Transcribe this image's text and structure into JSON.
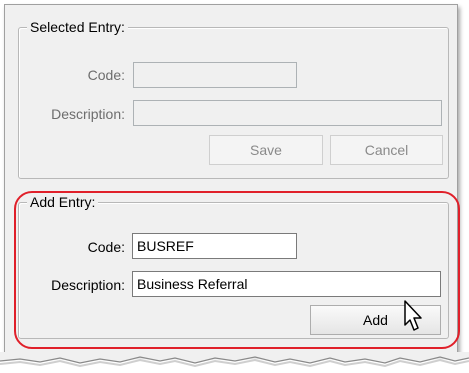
{
  "selected_entry": {
    "title": "Selected Entry:",
    "code_label": "Code:",
    "code_value": "",
    "description_label": "Description:",
    "description_value": "",
    "save_label": "Save",
    "cancel_label": "Cancel"
  },
  "add_entry": {
    "title": "Add Entry:",
    "code_label": "Code:",
    "code_value": "BUSREF",
    "description_label": "Description:",
    "description_value": "Business Referral",
    "add_label": "Add"
  },
  "colors": {
    "highlight": "#e0202a",
    "dialog_bg": "#f0f0f0"
  },
  "icons": {
    "cursor": "mouse-pointer-icon"
  }
}
